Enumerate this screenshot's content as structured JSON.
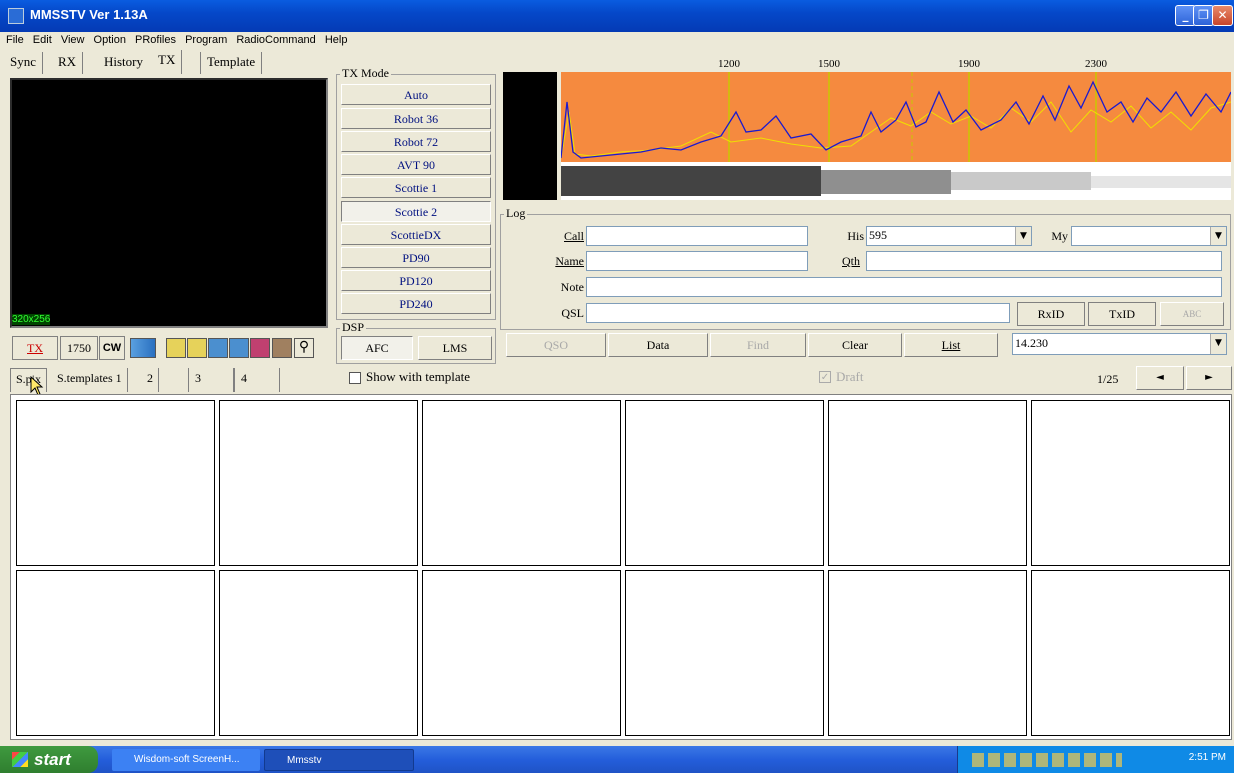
{
  "window": {
    "title": "MMSSTV Ver 1.13A"
  },
  "menu": [
    "File",
    "Edit",
    "View",
    "Option",
    "PRofiles",
    "Program",
    "RadioCommand",
    "Help"
  ],
  "top_tabs": [
    "Sync",
    "RX",
    "History",
    "TX",
    "Template"
  ],
  "tx_image": {
    "size_label": "320x256"
  },
  "toolbar": {
    "tx_label": "TX",
    "tone_label": "1750",
    "cw_label": "CW"
  },
  "tx_mode": {
    "title": "TX Mode",
    "modes": [
      "Auto",
      "Robot 36",
      "Robot 72",
      "AVT 90",
      "Scottie 1",
      "Scottie 2",
      "ScottieDX",
      "PD90",
      "PD120",
      "PD240"
    ],
    "selected": "Scottie 2"
  },
  "dsp": {
    "title": "DSP",
    "afc_label": "AFC",
    "lms_label": "LMS"
  },
  "spectrum": {
    "freq_labels": [
      "1200",
      "1500",
      "1900",
      "2300"
    ],
    "bg_color": "#f58a3f"
  },
  "log": {
    "title": "Log",
    "call_label": "Call",
    "call_value": "",
    "his_label": "His",
    "his_value": "595",
    "my_label": "My",
    "my_value": "",
    "name_label": "Name",
    "name_value": "",
    "qth_label": "Qth",
    "qth_value": "",
    "note_label": "Note",
    "note_value": "",
    "qsl_label": "QSL",
    "qsl_value": "",
    "rxid_label": "RxID",
    "txid_label": "TxID"
  },
  "log_buttons": {
    "qso": "QSO",
    "data": "Data",
    "find": "Find",
    "clear": "Clear",
    "list": "List",
    "freq": "14.230"
  },
  "bottom_tabs": [
    "S.pix",
    "S.templates 1",
    "2",
    "3",
    "4"
  ],
  "show_with_template": "Show with template",
  "draft_label": "Draft",
  "pager": {
    "text": "1/25",
    "prev": "◄",
    "next": "►"
  },
  "taskbar": {
    "start": "start",
    "items": [
      "Wisdom-soft ScreenH...",
      "Mmsstv"
    ],
    "clock": "2:51 PM"
  }
}
